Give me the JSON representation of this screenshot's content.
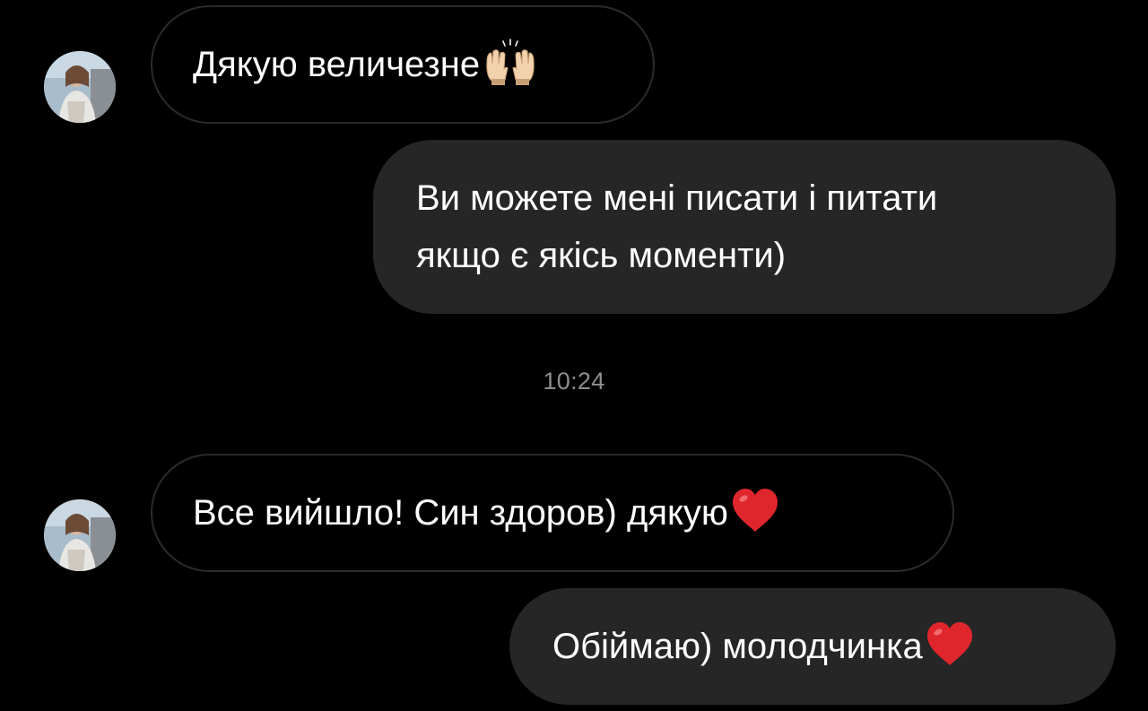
{
  "colors": {
    "background": "#000000",
    "incoming_border": "#2b2b2b",
    "outgoing_bubble": "#262626",
    "text": "#ffffff",
    "timestamp": "#8e8e8e",
    "heart": "#e0262d"
  },
  "messages": [
    {
      "direction": "incoming",
      "text": "Дякую величезне",
      "emoji": "raising-hands-emoji"
    },
    {
      "direction": "outgoing",
      "lines": [
        "Ви можете мені писати і питати",
        "якщо є якісь моменти)"
      ]
    },
    {
      "direction": "timestamp",
      "text": "10:24"
    },
    {
      "direction": "incoming",
      "text": "Все вийшло! Син здоров) дякую",
      "emoji": "red-heart-emoji"
    },
    {
      "direction": "outgoing",
      "text": "Обіймаю) молодчинка",
      "emoji": "red-heart-emoji"
    }
  ]
}
